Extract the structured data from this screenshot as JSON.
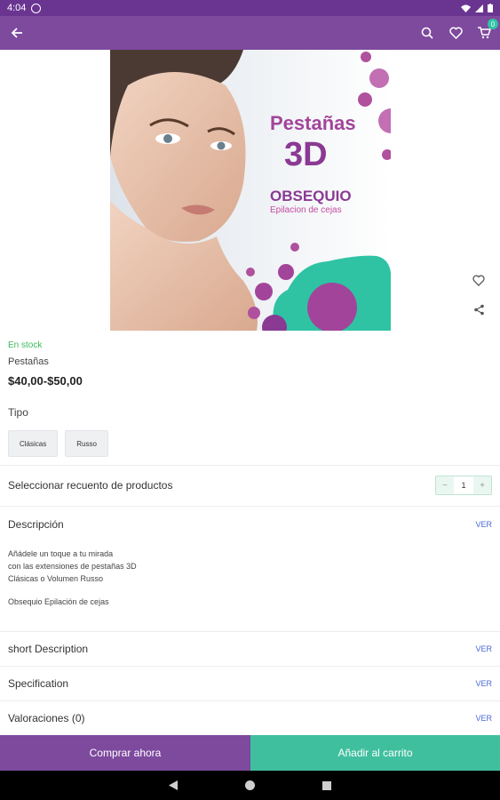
{
  "status_bar": {
    "time": "4:04"
  },
  "app_bar": {
    "cart_count": "0"
  },
  "hero": {
    "heading": "Pestañas",
    "heading_big": "3D",
    "gift": "OBSEQUIO",
    "gift_sub": "Epilacion de cejas",
    "colors": {
      "purple": "#b0519d",
      "teal": "#2fc3a4"
    }
  },
  "product": {
    "stock": "En stock",
    "category": "Pestañas",
    "price": "$40,00-$50,00",
    "option_label": "Tipo",
    "options": [
      "Clásicas",
      "Russo"
    ]
  },
  "quantity": {
    "label": "Seleccionar recuento de productos",
    "value": "1",
    "minus": "−",
    "plus": "+"
  },
  "sections": {
    "description": {
      "label": "Descripción",
      "ver": "VER"
    },
    "short_description": {
      "label": "short Description",
      "ver": "VER"
    },
    "specification": {
      "label": "Specification",
      "ver": "VER"
    },
    "reviews": {
      "label": "Valoraciones (0)",
      "ver": "VER"
    }
  },
  "description_text": {
    "line1": "Añádele un toque a tu mirada",
    "line2": "con las extensiones de pestañas 3D",
    "line3": "Clásicas o Volumen Russo",
    "line4": "Obsequio Epilación de cejas"
  },
  "buttons": {
    "buy_now": "Comprar ahora",
    "add_to_cart": "Añadir al carrito"
  },
  "theme": {
    "primary": "#7d4a9e",
    "accent": "#40bf9f",
    "stock_green": "#3cb95d",
    "link_blue": "#4a67d6"
  }
}
